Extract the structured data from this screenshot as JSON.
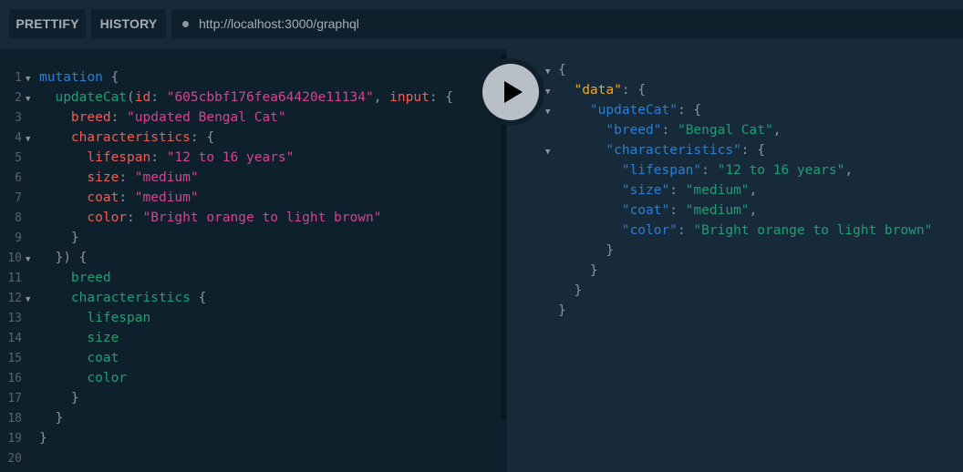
{
  "toolbar": {
    "prettify": "PRETTIFY",
    "history": "HISTORY",
    "url": "http://localhost:3000/graphql"
  },
  "query_lines": [
    {
      "n": "1",
      "fold": true,
      "tokens": [
        [
          "mutation",
          "kw"
        ],
        [
          " {",
          "pn"
        ]
      ]
    },
    {
      "n": "2",
      "fold": true,
      "tokens": [
        [
          "  ",
          ""
        ],
        [
          "updateCat",
          "fd"
        ],
        [
          "(",
          "pn"
        ],
        [
          "id",
          "ag"
        ],
        [
          ": ",
          "pn"
        ],
        [
          "\"605cbbf176fea64420e11134\"",
          "st"
        ],
        [
          ", ",
          "pn"
        ],
        [
          "input",
          "ag"
        ],
        [
          ": {",
          "pn"
        ]
      ]
    },
    {
      "n": "3",
      "fold": false,
      "tokens": [
        [
          "    ",
          ""
        ],
        [
          "breed",
          "ag"
        ],
        [
          ": ",
          "pn"
        ],
        [
          "\"updated Bengal Cat\"",
          "st"
        ]
      ]
    },
    {
      "n": "4",
      "fold": true,
      "tokens": [
        [
          "    ",
          ""
        ],
        [
          "characteristics",
          "ag"
        ],
        [
          ": {",
          "pn"
        ]
      ]
    },
    {
      "n": "5",
      "fold": false,
      "tokens": [
        [
          "      ",
          ""
        ],
        [
          "lifespan",
          "ag"
        ],
        [
          ": ",
          "pn"
        ],
        [
          "\"12 to 16 years\"",
          "st"
        ]
      ]
    },
    {
      "n": "6",
      "fold": false,
      "tokens": [
        [
          "      ",
          ""
        ],
        [
          "size",
          "ag"
        ],
        [
          ": ",
          "pn"
        ],
        [
          "\"medium\"",
          "st"
        ]
      ]
    },
    {
      "n": "7",
      "fold": false,
      "tokens": [
        [
          "      ",
          ""
        ],
        [
          "coat",
          "ag"
        ],
        [
          ": ",
          "pn"
        ],
        [
          "\"medium\"",
          "st"
        ]
      ]
    },
    {
      "n": "8",
      "fold": false,
      "tokens": [
        [
          "      ",
          ""
        ],
        [
          "color",
          "ag"
        ],
        [
          ": ",
          "pn"
        ],
        [
          "\"Bright orange to light brown\"",
          "st"
        ]
      ]
    },
    {
      "n": "9",
      "fold": false,
      "tokens": [
        [
          "    }",
          "pn"
        ]
      ]
    },
    {
      "n": "10",
      "fold": true,
      "tokens": [
        [
          "  }) {",
          "pn"
        ]
      ]
    },
    {
      "n": "11",
      "fold": false,
      "tokens": [
        [
          "    ",
          ""
        ],
        [
          "breed",
          "fd"
        ]
      ]
    },
    {
      "n": "12",
      "fold": true,
      "tokens": [
        [
          "    ",
          ""
        ],
        [
          "characteristics",
          "fd"
        ],
        [
          " {",
          "pn"
        ]
      ]
    },
    {
      "n": "13",
      "fold": false,
      "tokens": [
        [
          "      ",
          ""
        ],
        [
          "lifespan",
          "fd"
        ]
      ]
    },
    {
      "n": "14",
      "fold": false,
      "tokens": [
        [
          "      ",
          ""
        ],
        [
          "size",
          "fd"
        ]
      ]
    },
    {
      "n": "15",
      "fold": false,
      "tokens": [
        [
          "      ",
          ""
        ],
        [
          "coat",
          "fd"
        ]
      ]
    },
    {
      "n": "16",
      "fold": false,
      "tokens": [
        [
          "      ",
          ""
        ],
        [
          "color",
          "fd"
        ]
      ]
    },
    {
      "n": "17",
      "fold": false,
      "tokens": [
        [
          "    }",
          "pn"
        ]
      ]
    },
    {
      "n": "18",
      "fold": false,
      "tokens": [
        [
          "  }",
          "pn"
        ]
      ]
    },
    {
      "n": "19",
      "fold": false,
      "tokens": [
        [
          "}",
          "pn"
        ]
      ]
    },
    {
      "n": "20",
      "fold": false,
      "tokens": []
    }
  ],
  "result_lines": [
    {
      "fold": true,
      "tokens": [
        [
          "{",
          "pn"
        ]
      ]
    },
    {
      "fold": true,
      "tokens": [
        [
          "  ",
          ""
        ],
        [
          "\"data\"",
          "dk"
        ],
        [
          ": {",
          "pn"
        ]
      ]
    },
    {
      "fold": true,
      "tokens": [
        [
          "    ",
          ""
        ],
        [
          "\"updateCat\"",
          "ky"
        ],
        [
          ": {",
          "pn"
        ]
      ]
    },
    {
      "fold": false,
      "tokens": [
        [
          "      ",
          ""
        ],
        [
          "\"breed\"",
          "ky"
        ],
        [
          ": ",
          "pn"
        ],
        [
          "\"Bengal Cat\"",
          "sv"
        ],
        [
          ",",
          "pn"
        ]
      ]
    },
    {
      "fold": true,
      "tokens": [
        [
          "      ",
          ""
        ],
        [
          "\"characteristics\"",
          "ky"
        ],
        [
          ": {",
          "pn"
        ]
      ]
    },
    {
      "fold": false,
      "tokens": [
        [
          "        ",
          ""
        ],
        [
          "\"lifespan\"",
          "ky"
        ],
        [
          ": ",
          "pn"
        ],
        [
          "\"12 to 16 years\"",
          "sv"
        ],
        [
          ",",
          "pn"
        ]
      ]
    },
    {
      "fold": false,
      "tokens": [
        [
          "        ",
          ""
        ],
        [
          "\"size\"",
          "ky"
        ],
        [
          ": ",
          "pn"
        ],
        [
          "\"medium\"",
          "sv"
        ],
        [
          ",",
          "pn"
        ]
      ]
    },
    {
      "fold": false,
      "tokens": [
        [
          "        ",
          ""
        ],
        [
          "\"coat\"",
          "ky"
        ],
        [
          ": ",
          "pn"
        ],
        [
          "\"medium\"",
          "sv"
        ],
        [
          ",",
          "pn"
        ]
      ]
    },
    {
      "fold": false,
      "tokens": [
        [
          "        ",
          ""
        ],
        [
          "\"color\"",
          "ky"
        ],
        [
          ": ",
          "pn"
        ],
        [
          "\"Bright orange to light brown\"",
          "sv"
        ]
      ]
    },
    {
      "fold": false,
      "tokens": [
        [
          "      }",
          "pn"
        ]
      ]
    },
    {
      "fold": false,
      "tokens": [
        [
          "    }",
          "pn"
        ]
      ]
    },
    {
      "fold": false,
      "tokens": [
        [
          "  }",
          "pn"
        ]
      ]
    },
    {
      "fold": false,
      "tokens": [
        [
          "}",
          "pn"
        ]
      ]
    }
  ]
}
